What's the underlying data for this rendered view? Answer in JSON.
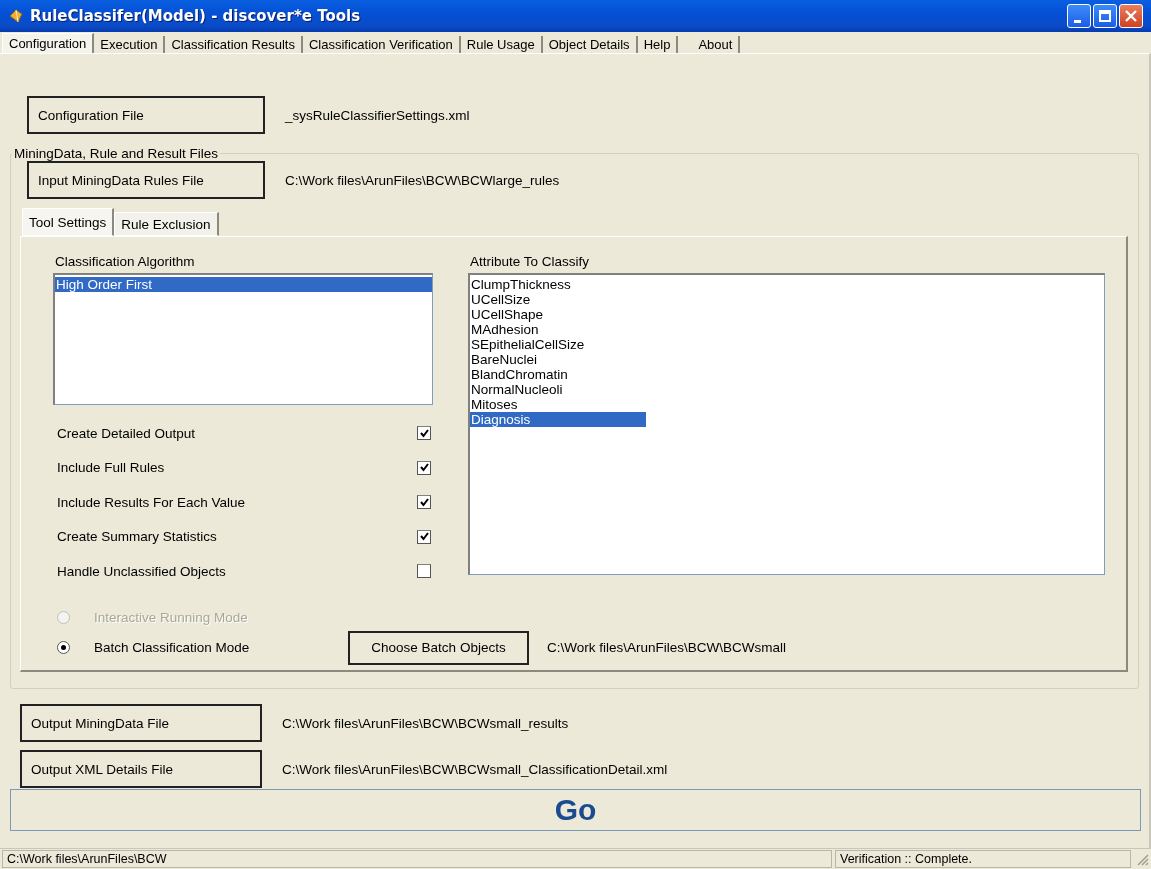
{
  "window": {
    "title": "RuleClassifer(Model) - discover*e Tools"
  },
  "tabs": [
    {
      "label": "Configuration",
      "selected": true
    },
    {
      "label": "Execution",
      "selected": false
    },
    {
      "label": "Classification Results",
      "selected": false
    },
    {
      "label": "Classification Verification",
      "selected": false
    },
    {
      "label": "Rule Usage",
      "selected": false
    },
    {
      "label": "Object Details",
      "selected": false
    },
    {
      "label": "Help",
      "selected": false
    },
    {
      "label": "About",
      "selected": false
    }
  ],
  "configuration_file": {
    "button": "Configuration File",
    "value": "_sysRuleClassifierSettings.xml"
  },
  "files_group": {
    "title": "MiningData, Rule and Result Files",
    "input_rules": {
      "button": "Input MiningData Rules File",
      "value": "C:\\Work files\\ArunFiles\\BCW\\BCWlarge_rules"
    },
    "subtabs": [
      {
        "label": "Tool Settings",
        "selected": true
      },
      {
        "label": "Rule Exclusion",
        "selected": false
      }
    ],
    "algorithm": {
      "label": "Classification Algorithm",
      "items": [
        {
          "label": "High Order First",
          "selected": true
        }
      ]
    },
    "attribute": {
      "label": "Attribute To Classify",
      "items": [
        {
          "label": "ClumpThickness",
          "selected": false
        },
        {
          "label": "UCellSize",
          "selected": false
        },
        {
          "label": "UCellShape",
          "selected": false
        },
        {
          "label": "MAdhesion",
          "selected": false
        },
        {
          "label": "SEpithelialCellSize",
          "selected": false
        },
        {
          "label": "BareNuclei",
          "selected": false
        },
        {
          "label": "BlandChromatin",
          "selected": false
        },
        {
          "label": "NormalNucleoli",
          "selected": false
        },
        {
          "label": "Mitoses",
          "selected": false
        },
        {
          "label": "Diagnosis",
          "selected": true
        }
      ]
    },
    "options": [
      {
        "label": "Create Detailed Output",
        "checked": true
      },
      {
        "label": "Include Full Rules",
        "checked": true
      },
      {
        "label": "Include Results For Each Value",
        "checked": true
      },
      {
        "label": "Create Summary Statistics",
        "checked": true
      },
      {
        "label": "Handle Unclassified Objects",
        "checked": false
      }
    ],
    "modes": [
      {
        "label": "Interactive Running Mode",
        "selected": false,
        "disabled": true
      },
      {
        "label": "Batch Classification Mode",
        "selected": true,
        "disabled": false
      }
    ],
    "batch": {
      "button": "Choose Batch Objects",
      "value": "C:\\Work files\\ArunFiles\\BCW\\BCWsmall"
    }
  },
  "outputs": [
    {
      "button": "Output MiningData File",
      "value": "C:\\Work files\\ArunFiles\\BCW\\BCWsmall_results"
    },
    {
      "button": "Output XML Details File",
      "value": "C:\\Work files\\ArunFiles\\BCW\\BCWsmall_ClassificationDetail.xml"
    }
  ],
  "go_button": "Go",
  "status_bar": [
    "C:\\Work files\\ArunFiles\\BCW",
    "Verification :: Complete."
  ]
}
